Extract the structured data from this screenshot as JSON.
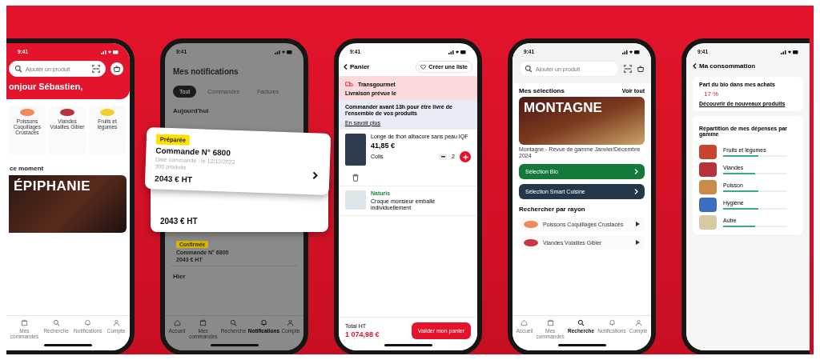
{
  "phones": [
    {
      "kind": "home",
      "time": "9:41",
      "search": {
        "placeholder": "Ajouter un produit"
      },
      "greeting": "onjour Sébastien,",
      "categories": [
        {
          "label": "Poissons Coquillages Crustacés"
        },
        {
          "label": "Viandes Volailles Gibier"
        },
        {
          "label": "Fruits et légumes"
        }
      ],
      "section_title": "ce moment",
      "banner": {
        "title": "ÉPIPHANIE"
      },
      "nav": [
        {
          "label": "Mes commandes",
          "selected": false
        },
        {
          "label": "Recherche",
          "selected": false
        },
        {
          "label": "Notifications",
          "selected": false
        },
        {
          "label": "Compte",
          "selected": false
        }
      ]
    },
    {
      "kind": "notifications",
      "time": "9:41",
      "title": "Mes notifications",
      "tabs": [
        {
          "label": "Tout",
          "selected": true
        },
        {
          "label": "Commandes",
          "selected": false
        },
        {
          "label": "Factures",
          "selected": false
        }
      ],
      "day": "Aujourd'hui",
      "cards": [
        {
          "status": "Préparée",
          "title": "Commande N° 6800",
          "date": "Date commande : le 12/12/2022",
          "count": "300 produits",
          "amount": "2043 € HT"
        },
        {
          "amount": "2043 € HT"
        }
      ],
      "list_item": {
        "status": "Confirmée",
        "title": "Commande N° 6800",
        "amount": "2043 € HT"
      },
      "day2": "Hier",
      "nav": [
        {
          "label": "Accueil",
          "selected": false
        },
        {
          "label": "Mes commandes",
          "selected": false
        },
        {
          "label": "Recherche",
          "selected": false
        },
        {
          "label": "Notifications",
          "selected": true
        },
        {
          "label": "Compte",
          "selected": false
        }
      ]
    },
    {
      "kind": "cart",
      "time": "9:41",
      "title": "Panier",
      "list_button": "Créer une liste",
      "supplier": "Transgourmet",
      "delivery": "Livraison prévue le",
      "info": "Commander avant 13h pour être livré de l'ensemble de vos produits",
      "info_link": "En savoir plus",
      "products": [
        {
          "name": "Longe de thon albacore sans peau IQF",
          "price": "41,85 €",
          "unit": "Colis",
          "qty": "2"
        },
        {
          "brand": "Naturis",
          "name": "Croque monsieur emballé individuellement"
        }
      ],
      "total_label": "Total HT",
      "total": "1 074,98 €",
      "checkout": "Valider mon panier"
    },
    {
      "kind": "search",
      "time": "9:41",
      "search": {
        "placeholder": "Ajouter un produit"
      },
      "section_title": "Mes sélections",
      "see_all": "Voir tout",
      "banner": {
        "title": "MONTAGNE",
        "caption": "Montagne - Revue de gamme Janvier/Décembre 2024"
      },
      "selections": [
        {
          "label": "Sélection Bio",
          "kind": "green"
        },
        {
          "label": "Sélection Smart Cuisine",
          "kind": "dark"
        }
      ],
      "aisles_title": "Rechercher par rayon",
      "aisles": [
        {
          "label": "Poissons Coquillages Crustacés"
        },
        {
          "label": "Viandes Volailles Gibier"
        }
      ],
      "nav": [
        {
          "label": "Accueil",
          "selected": false
        },
        {
          "label": "Mes commandes",
          "selected": false
        },
        {
          "label": "Recherche",
          "selected": true
        },
        {
          "label": "Notifications",
          "selected": false
        },
        {
          "label": "Compte",
          "selected": false
        }
      ]
    },
    {
      "kind": "consumption",
      "time": "9:41",
      "title": "Ma consommation",
      "bio_title": "Part du bio dans mes achats",
      "bio_value": "17 %",
      "bio_link": "Découvrir de nouveaux produits",
      "split_title": "Répartition de mes dépenses par gamme",
      "rows": [
        {
          "name": "Fruits et légumes",
          "level": 0.55
        },
        {
          "name": "Viandes",
          "level": 0.5
        },
        {
          "name": "Poisson",
          "level": 0.55
        },
        {
          "name": "Hygiène",
          "level": 0.55
        },
        {
          "name": "Autre",
          "level": 0.5
        }
      ]
    }
  ]
}
